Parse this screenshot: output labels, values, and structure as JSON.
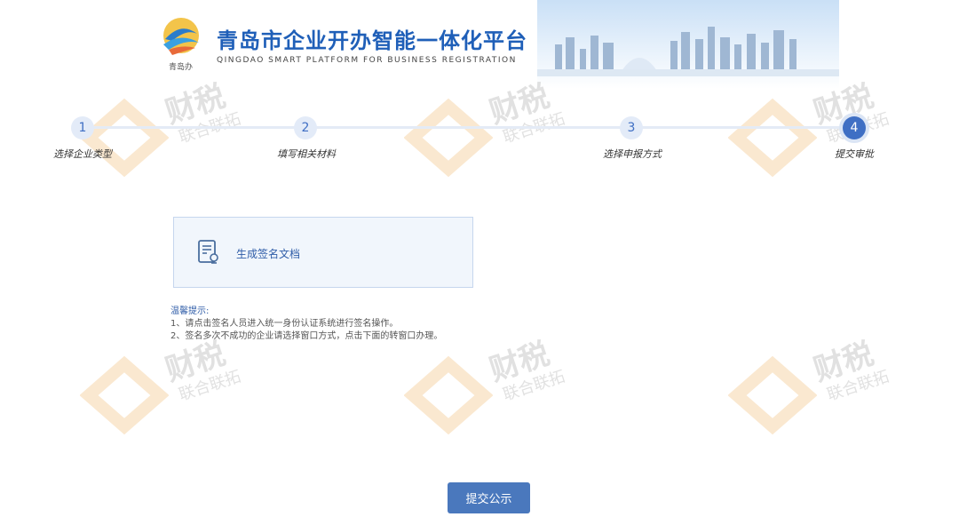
{
  "header": {
    "logo_caption": "青岛办",
    "title": "青岛市企业开办智能一体化平台",
    "subtitle": "QINGDAO SMART PLATFORM FOR BUSINESS REGISTRATION"
  },
  "steps": [
    {
      "number": "1",
      "label": "选择企业类型",
      "active": false
    },
    {
      "number": "2",
      "label": "填写相关材料",
      "active": false
    },
    {
      "number": "3",
      "label": "选择申报方式",
      "active": false
    },
    {
      "number": "4",
      "label": "提交审批",
      "active": true
    }
  ],
  "doc_card": {
    "label": "生成签名文档",
    "icon": "document-certificate-icon"
  },
  "tips": {
    "title": "温馨提示:",
    "line1": "1、请点击签名人员进入统一身份认证系统进行签名操作。",
    "line2": "2、签名多次不成功的企业请选择窗口方式，点击下面的转窗口办理。"
  },
  "actions": {
    "submit_label": "提交公示"
  },
  "watermark": {
    "line1": "财税",
    "line2": "联合联拓"
  },
  "colors": {
    "brand": "#1f5fb8",
    "accent": "#4a78bd",
    "card_bg": "#f1f6fc"
  }
}
